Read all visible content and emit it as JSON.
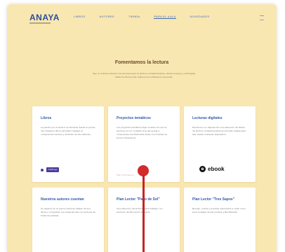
{
  "brand": {
    "logo": "ANAYA"
  },
  "nav": {
    "items": [
      {
        "label": "LIBROS"
      },
      {
        "label": "AUTORES"
      },
      {
        "label": "TIENDA"
      },
      {
        "label": "PARA EL AULA"
      },
      {
        "label": "NOVEDADES"
      }
    ]
  },
  "hero": {
    "title": "Fomentamos la lectura",
    "text": "Hay un extenso abanico de recursos para la lectura complementaria, desde ensayos y antologías hasta los títulos más clásicos de la literatura universal."
  },
  "cards": [
    {
      "title": "Libros",
      "text": "La pasión por la lectura se fomenta desde el primer día. Nuestros libros permiten trabajar la comprensión lectora y disfrutar de las historias.",
      "badge": "Catálogo"
    },
    {
      "title": "Proyectos temáticos",
      "text": "Los proyectos temáticos fijan la atención de los alumnos en un contexto que les ayuda a comprender las diferentes áreas curriculares de forma motivadora.",
      "link": "Más información"
    },
    {
      "title": "Lecturas digitales",
      "text": "Ponemos a su disposición una selección de títulos de lectura complementaria en formato digital para leer desde cualquier dispositivo.",
      "ebook": "ebook"
    },
    {
      "title": "Nuestros autores cuentan",
      "text": "Un espacio en el que los autores hablan de sus libros y comparten sus experiencias con lectores de todas las edades."
    },
    {
      "title": "Plan Lector \"Paso de Sol\"",
      "text": "Una selección de lecturas para trabajar con alumnos de Educación Primaria."
    },
    {
      "title": "Plan Lector \"Tres Sapos\"",
      "text": "Novela, cuento y poemas adecuados a cada curso para la etapa de Secundaria y Bachillerato."
    }
  ],
  "colors": {
    "background": "#f9e7b2",
    "primary": "#2f5aa6",
    "pointer": "#d12b2b"
  }
}
